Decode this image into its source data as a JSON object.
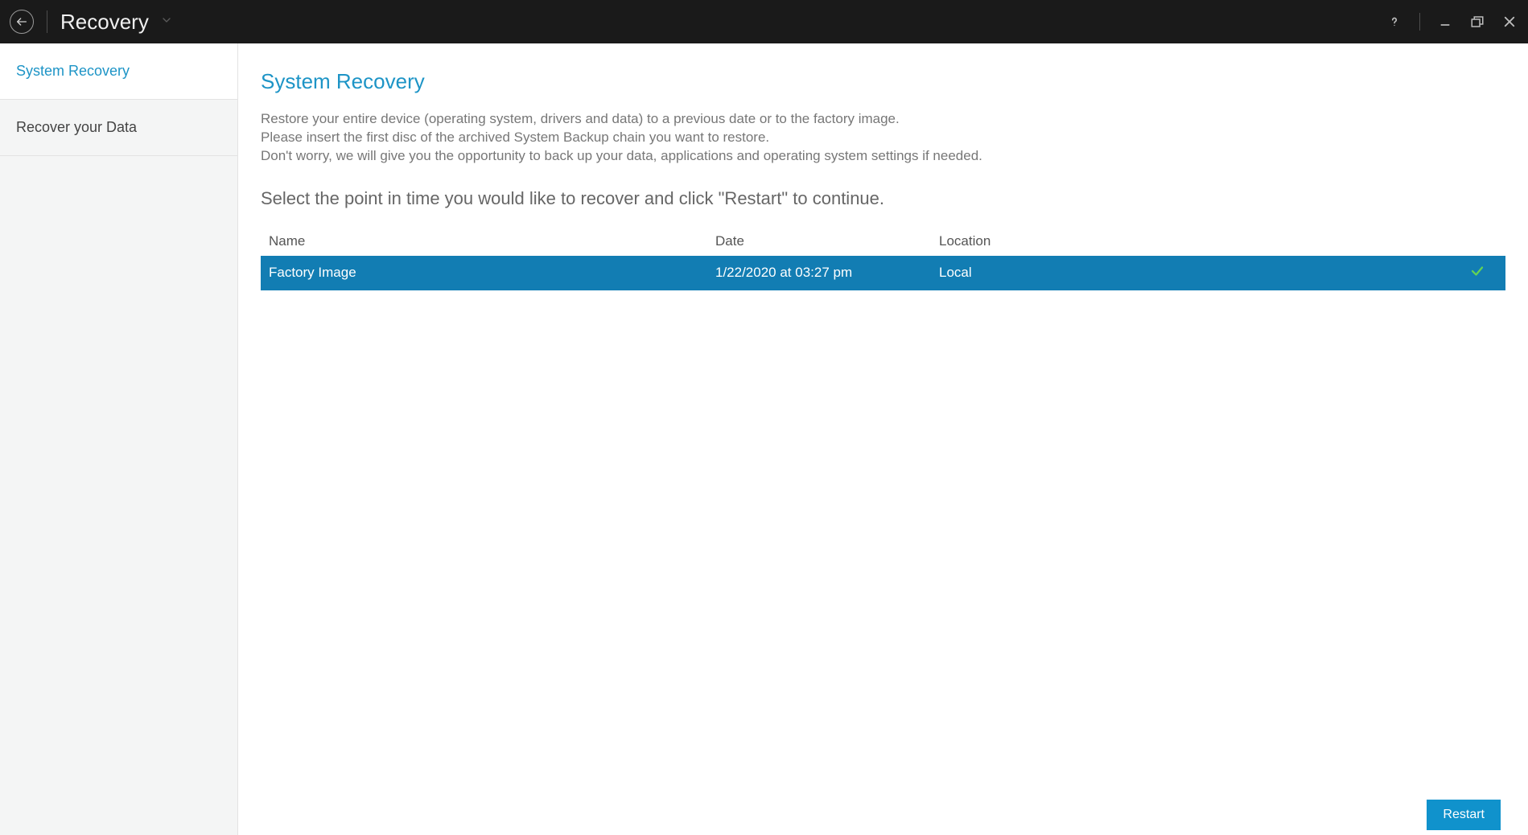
{
  "titlebar": {
    "title": "Recovery"
  },
  "sidebar": {
    "items": [
      {
        "label": "System Recovery",
        "active": true
      },
      {
        "label": "Recover your Data",
        "active": false
      }
    ]
  },
  "main": {
    "heading": "System Recovery",
    "description_line1": "Restore your entire device (operating system, drivers and data) to a previous date or to the factory image.",
    "description_line2": "Please insert the first disc of the archived System Backup chain you want to restore.",
    "description_line3": "Don't worry, we will give you the opportunity to back up your data, applications and operating system settings if needed.",
    "instruction": "Select the point in time you would like to recover and click \"Restart\" to continue.",
    "columns": {
      "name": "Name",
      "date": "Date",
      "location": "Location"
    },
    "rows": [
      {
        "name": "Factory Image",
        "date": "1/22/2020 at 03:27 pm",
        "location": "Local",
        "selected": true
      }
    ],
    "restart_label": "Restart"
  }
}
